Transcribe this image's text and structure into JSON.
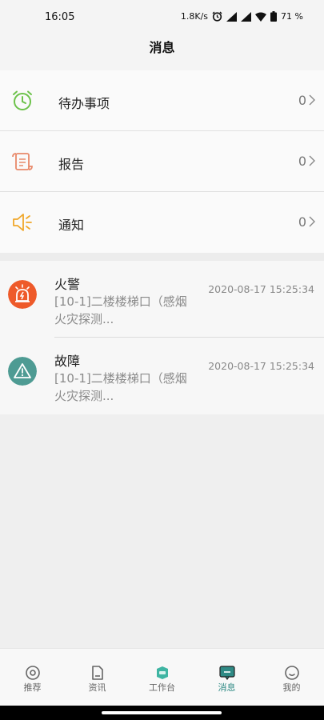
{
  "status": {
    "time": "16:05",
    "speed": "1.8K/s",
    "battery": "71 %",
    "icons": [
      "alarm-icon",
      "signal-icon",
      "signal-icon",
      "wifi-icon",
      "battery-icon"
    ]
  },
  "header": {
    "title": "消息"
  },
  "menu": {
    "items": [
      {
        "label": "待办事项",
        "count": "0",
        "icon": "clock-icon",
        "color": "#6cc24a"
      },
      {
        "label": "报告",
        "count": "0",
        "icon": "scroll-icon",
        "color": "#e8896a"
      },
      {
        "label": "通知",
        "count": "0",
        "icon": "speaker-icon",
        "color": "#f0a72a"
      }
    ]
  },
  "messages": [
    {
      "title": "火警",
      "time": "2020-08-17 15:25:34",
      "body": "[10-1]二楼楼梯口（感烟火灾探测...",
      "icon": "fire-alarm-icon",
      "color": "#ee5a2a"
    },
    {
      "title": "故障",
      "time": "2020-08-17 15:25:34",
      "body": "[10-1]二楼楼梯口（感烟火灾探测...",
      "icon": "warning-icon",
      "color": "#4e9b93"
    }
  ],
  "tabbar": {
    "tabs": [
      {
        "label": "推荐",
        "icon": "target-icon"
      },
      {
        "label": "资讯",
        "icon": "document-icon"
      },
      {
        "label": "工作台",
        "icon": "workbench-icon"
      },
      {
        "label": "消息",
        "icon": "message-icon",
        "active": true
      },
      {
        "label": "我的",
        "icon": "smiley-icon"
      }
    ]
  },
  "colors": {
    "accent": "#2f8a85",
    "background": "#efefef"
  }
}
